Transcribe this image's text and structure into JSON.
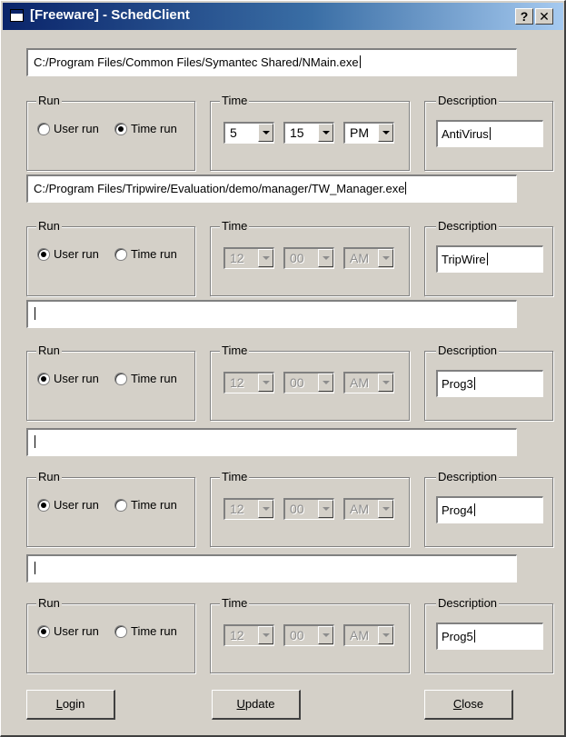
{
  "window": {
    "title": "[Freeware] - SchedClient",
    "help_label": "?",
    "close_label": "✕"
  },
  "entries": [
    {
      "path": "C:/Program Files/Common Files/Symantec Shared/NMain.exe",
      "run_label": "Run",
      "user_run_label": "User run",
      "time_run_label": "Time run",
      "selected_run": "time",
      "time_label": "Time",
      "hour": "5",
      "minute": "15",
      "ampm": "PM",
      "time_enabled": true,
      "description_label": "Description",
      "description": "AntiVirus"
    },
    {
      "path": "C:/Program Files/Tripwire/Evaluation/demo/manager/TW_Manager.exe",
      "run_label": "Run",
      "user_run_label": "User run",
      "time_run_label": "Time run",
      "selected_run": "user",
      "time_label": "Time",
      "hour": "12",
      "minute": "00",
      "ampm": "AM",
      "time_enabled": false,
      "description_label": "Description",
      "description": "TripWire"
    },
    {
      "path": "",
      "run_label": "Run",
      "user_run_label": "User run",
      "time_run_label": "Time run",
      "selected_run": "user",
      "time_label": "Time",
      "hour": "12",
      "minute": "00",
      "ampm": "AM",
      "time_enabled": false,
      "description_label": "Description",
      "description": "Prog3"
    },
    {
      "path": "",
      "run_label": "Run",
      "user_run_label": "User run",
      "time_run_label": "Time run",
      "selected_run": "user",
      "time_label": "Time",
      "hour": "12",
      "minute": "00",
      "ampm": "AM",
      "time_enabled": false,
      "description_label": "Description",
      "description": "Prog4"
    },
    {
      "path": "",
      "run_label": "Run",
      "user_run_label": "User run",
      "time_run_label": "Time run",
      "selected_run": "user",
      "time_label": "Time",
      "hour": "12",
      "minute": "00",
      "ampm": "AM",
      "time_enabled": false,
      "description_label": "Description",
      "description": "Prog5"
    }
  ],
  "buttons": {
    "login": {
      "mnemonic": "L",
      "rest": "ogin"
    },
    "update": {
      "mnemonic": "U",
      "rest": "pdate"
    },
    "close": {
      "mnemonic": "C",
      "rest": "lose"
    }
  },
  "colors": {
    "dialog_face": "#d4d0c8",
    "title_gradient_start": "#0a246a",
    "title_gradient_end": "#a6caf0"
  }
}
